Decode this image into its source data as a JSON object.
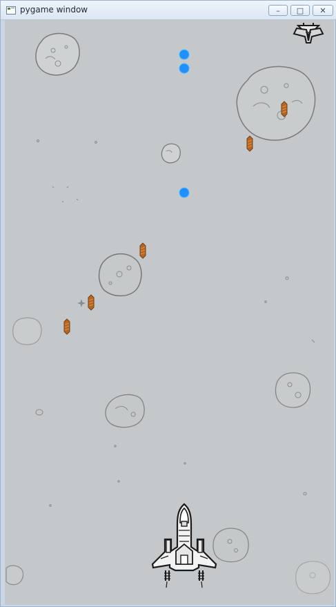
{
  "window": {
    "title": "pygame window",
    "buttons": {
      "minimize": "–",
      "maximize": "□",
      "close": "✕"
    }
  },
  "game": {
    "background_color": "#c4c8ca",
    "player_ship": "player-ship",
    "enemy_ship": "enemy-ship",
    "projectiles": {
      "blue_orbs": 3,
      "orange_missiles": 5
    },
    "asteroids": 10
  },
  "colors": {
    "orb": "#1e90ff",
    "missile": "#b7651f",
    "sketch": "#6f6f6f",
    "ship_outline": "#1b1b1b"
  }
}
